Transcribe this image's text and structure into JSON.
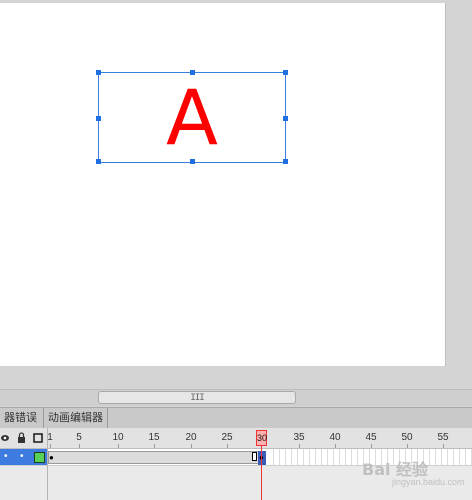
{
  "stage": {
    "selected_symbol_text": "A",
    "symbol_color": "#ff0000",
    "selection_color": "#3b7ddd",
    "background": "#ffffff"
  },
  "scrollbar": {
    "thumb_grip": "III"
  },
  "panel_tabs": [
    {
      "label": "器错误"
    },
    {
      "label": "动画编辑器"
    }
  ],
  "timeline": {
    "header_icons": [
      "eye-icon",
      "lock-icon",
      "outline-square-icon"
    ],
    "ruler_labels": [
      "1",
      "5",
      "10",
      "15",
      "20",
      "25",
      "30",
      "35",
      "40",
      "45",
      "50",
      "55"
    ],
    "current_frame": "30",
    "layer": {
      "visible_marker": "•",
      "lock_marker": "•",
      "color_swatch": "#56d356",
      "start_keyframe": "●",
      "end_keyframe": "●"
    },
    "playhead_color": "#ee3333"
  },
  "watermark": {
    "text": "Bai  经验",
    "sub": "jingyan.baidu.com"
  }
}
